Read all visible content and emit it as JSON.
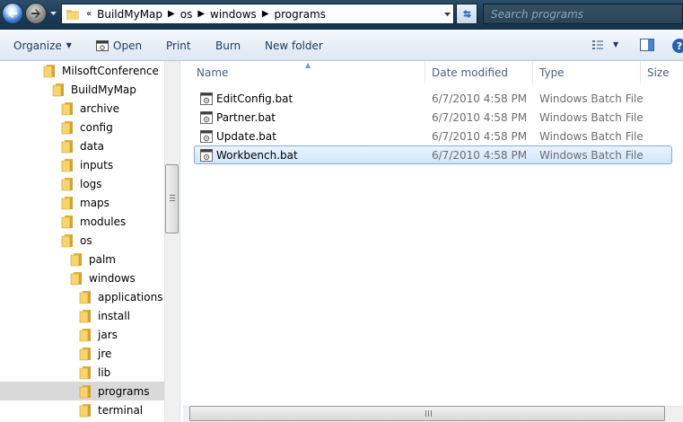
{
  "address": {
    "breadcrumb": [
      "BuildMyMap",
      "os",
      "windows",
      "programs"
    ],
    "overflow_marker": "«"
  },
  "search": {
    "placeholder": "Search programs"
  },
  "toolbar": {
    "organize": "Organize",
    "open": "Open",
    "print": "Print",
    "burn": "Burn",
    "new_folder": "New folder"
  },
  "tree": [
    {
      "label": "MilsoftConference",
      "level": 0
    },
    {
      "label": "BuildMyMap",
      "level": 1
    },
    {
      "label": "archive",
      "level": 2
    },
    {
      "label": "config",
      "level": 2
    },
    {
      "label": "data",
      "level": 2
    },
    {
      "label": "inputs",
      "level": 2
    },
    {
      "label": "logs",
      "level": 2
    },
    {
      "label": "maps",
      "level": 2
    },
    {
      "label": "modules",
      "level": 2
    },
    {
      "label": "os",
      "level": 2
    },
    {
      "label": "palm",
      "level": 3
    },
    {
      "label": "windows",
      "level": 3
    },
    {
      "label": "applications",
      "level": 4
    },
    {
      "label": "install",
      "level": 4
    },
    {
      "label": "jars",
      "level": 4
    },
    {
      "label": "jre",
      "level": 4
    },
    {
      "label": "lib",
      "level": 4
    },
    {
      "label": "programs",
      "level": 4,
      "selected": true
    },
    {
      "label": "terminal",
      "level": 4
    }
  ],
  "columns": {
    "name": "Name",
    "date": "Date modified",
    "type": "Type",
    "size": "Size"
  },
  "files": [
    {
      "name": "EditConfig.bat",
      "date": "6/7/2010 4:58 PM",
      "type": "Windows Batch File"
    },
    {
      "name": "Partner.bat",
      "date": "6/7/2010 4:58 PM",
      "type": "Windows Batch File"
    },
    {
      "name": "Update.bat",
      "date": "6/7/2010 4:58 PM",
      "type": "Windows Batch File"
    },
    {
      "name": "Workbench.bat",
      "date": "6/7/2010 4:58 PM",
      "type": "Windows Batch File",
      "selected": true
    }
  ]
}
